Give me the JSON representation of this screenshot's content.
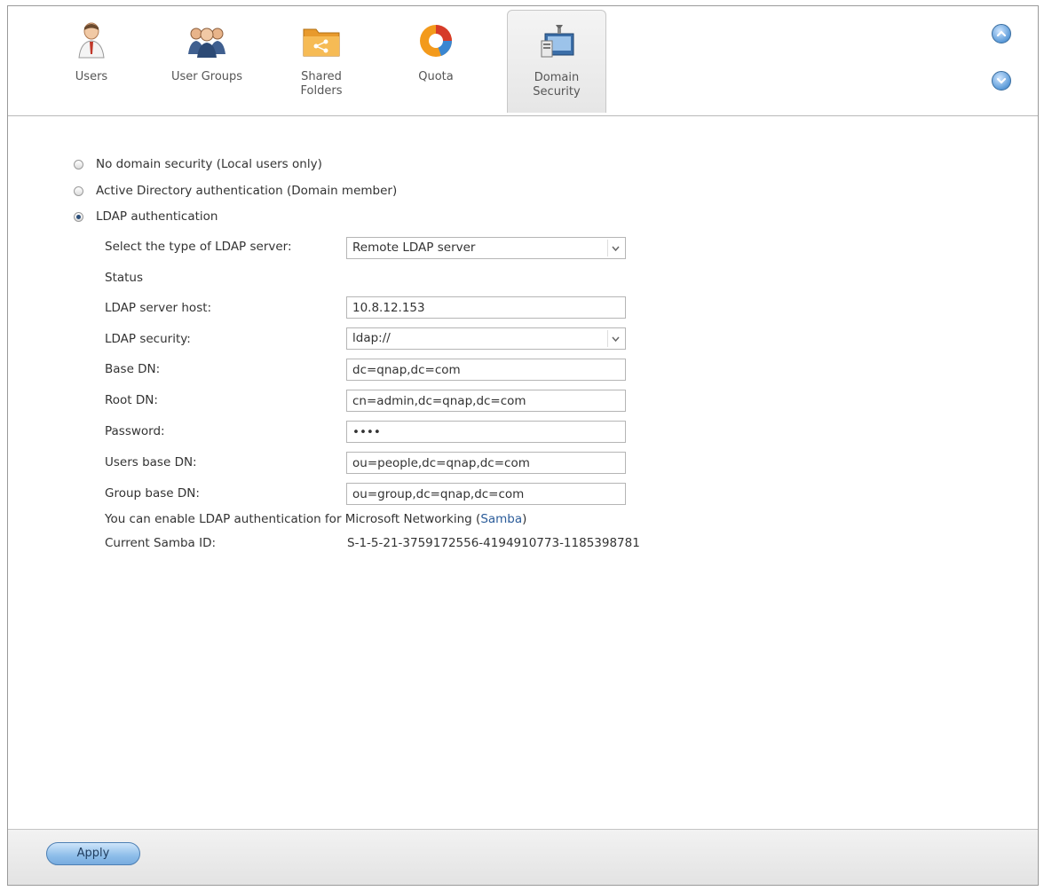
{
  "tabs": [
    {
      "label": "Users",
      "icon": "user-icon"
    },
    {
      "label": "User Groups",
      "icon": "user-groups-icon"
    },
    {
      "label": "Shared\nFolders",
      "icon": "shared-folders-icon"
    },
    {
      "label": "Quota",
      "icon": "quota-icon"
    },
    {
      "label": "Domain\nSecurity",
      "icon": "domain-security-icon"
    }
  ],
  "active_tab": "Domain Security",
  "security_options": [
    {
      "label": "No domain security (Local users only)",
      "checked": false
    },
    {
      "label": "Active Directory authentication (Domain member)",
      "checked": false
    },
    {
      "label": "LDAP authentication",
      "checked": true
    }
  ],
  "ldap": {
    "server_type_label": "Select the type of LDAP server:",
    "server_type_value": "Remote LDAP server",
    "status_label": "Status",
    "host_label": "LDAP server host:",
    "host_value": "10.8.12.153",
    "security_label": "LDAP security:",
    "security_value": "ldap://",
    "base_dn_label": "Base DN:",
    "base_dn_value": "dc=qnap,dc=com",
    "root_dn_label": "Root DN:",
    "root_dn_value": "cn=admin,dc=qnap,dc=com",
    "password_label": "Password:",
    "password_value": "••••",
    "users_base_dn_label": "Users base DN:",
    "users_base_dn_value": "ou=people,dc=qnap,dc=com",
    "group_base_dn_label": "Group base DN:",
    "group_base_dn_value": "ou=group,dc=qnap,dc=com",
    "samba_note_prefix": "You can enable LDAP authentication for Microsoft Networking (",
    "samba_link": "Samba",
    "samba_note_suffix": ")",
    "samba_id_label": "Current Samba ID:",
    "samba_id_value": "S-1-5-21-3759172556-4194910773-1185398781"
  },
  "apply_label": "Apply",
  "colors": {
    "accent": "#5b9ad8",
    "link": "#2b5c9a",
    "button": "#8dbde9"
  }
}
